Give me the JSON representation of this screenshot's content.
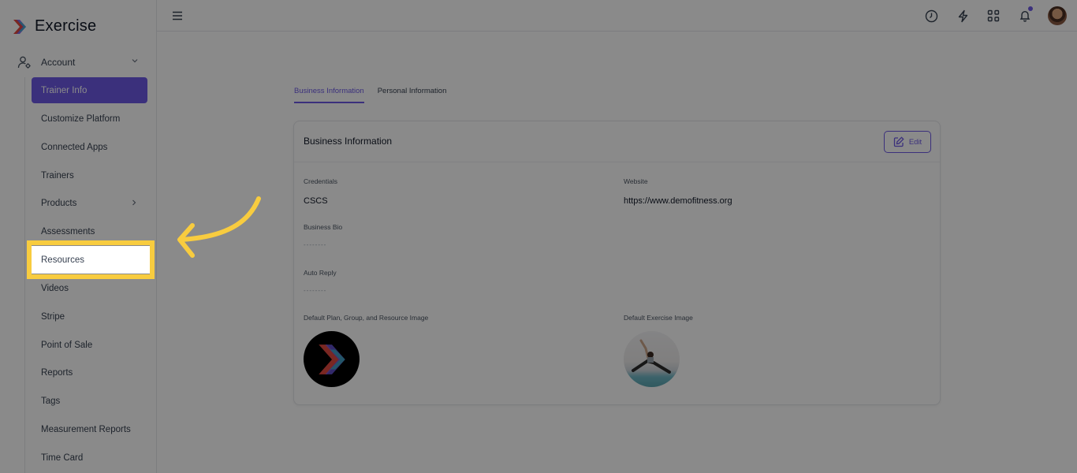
{
  "app": {
    "title": "Exercise"
  },
  "sidebar": {
    "account_label": "Account",
    "items": [
      {
        "label": "Trainer Info",
        "active": true
      },
      {
        "label": "Customize Platform"
      },
      {
        "label": "Connected Apps"
      },
      {
        "label": "Trainers"
      },
      {
        "label": "Products",
        "has_submenu": true
      },
      {
        "label": "Assessments"
      },
      {
        "label": "Resources",
        "highlighted": true
      },
      {
        "label": "Videos"
      },
      {
        "label": "Stripe"
      },
      {
        "label": "Point of Sale"
      },
      {
        "label": "Reports"
      },
      {
        "label": "Tags"
      },
      {
        "label": "Measurement Reports"
      },
      {
        "label": "Time Card"
      }
    ]
  },
  "topbar": {
    "icons": [
      "menu-icon",
      "clock-icon",
      "bolt-icon",
      "apps-grid-icon",
      "bell-icon"
    ],
    "has_notification": true
  },
  "tabs": [
    {
      "label": "Business Information",
      "active": true
    },
    {
      "label": "Personal Information"
    }
  ],
  "card": {
    "title": "Business Information",
    "edit_label": "Edit",
    "fields": {
      "credentials": {
        "label": "Credentials",
        "value": "CSCS"
      },
      "website": {
        "label": "Website",
        "value": "https://www.demofitness.org"
      },
      "business_bio": {
        "label": "Business Bio",
        "value": "--------"
      },
      "auto_reply": {
        "label": "Auto Reply",
        "value": "--------"
      },
      "default_plan_image": {
        "label": "Default Plan, Group, and Resource Image"
      },
      "default_exercise_image": {
        "label": "Default Exercise Image"
      }
    }
  },
  "colors": {
    "accent": "#6d5ae6",
    "highlight": "#f8cc3f"
  }
}
